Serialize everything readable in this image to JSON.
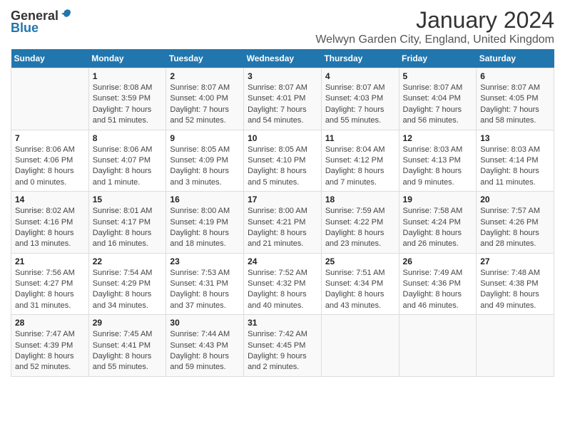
{
  "logo": {
    "general": "General",
    "blue": "Blue"
  },
  "header": {
    "title": "January 2024",
    "subtitle": "Welwyn Garden City, England, United Kingdom"
  },
  "days_of_week": [
    "Sunday",
    "Monday",
    "Tuesday",
    "Wednesday",
    "Thursday",
    "Friday",
    "Saturday"
  ],
  "weeks": [
    [
      {
        "num": "",
        "sunrise": "",
        "sunset": "",
        "daylight": ""
      },
      {
        "num": "1",
        "sunrise": "8:08 AM",
        "sunset": "3:59 PM",
        "daylight": "7 hours and 51 minutes."
      },
      {
        "num": "2",
        "sunrise": "8:07 AM",
        "sunset": "4:00 PM",
        "daylight": "7 hours and 52 minutes."
      },
      {
        "num": "3",
        "sunrise": "8:07 AM",
        "sunset": "4:01 PM",
        "daylight": "7 hours and 54 minutes."
      },
      {
        "num": "4",
        "sunrise": "8:07 AM",
        "sunset": "4:03 PM",
        "daylight": "7 hours and 55 minutes."
      },
      {
        "num": "5",
        "sunrise": "8:07 AM",
        "sunset": "4:04 PM",
        "daylight": "7 hours and 56 minutes."
      },
      {
        "num": "6",
        "sunrise": "8:07 AM",
        "sunset": "4:05 PM",
        "daylight": "7 hours and 58 minutes."
      }
    ],
    [
      {
        "num": "7",
        "sunrise": "8:06 AM",
        "sunset": "4:06 PM",
        "daylight": "8 hours and 0 minutes."
      },
      {
        "num": "8",
        "sunrise": "8:06 AM",
        "sunset": "4:07 PM",
        "daylight": "8 hours and 1 minute."
      },
      {
        "num": "9",
        "sunrise": "8:05 AM",
        "sunset": "4:09 PM",
        "daylight": "8 hours and 3 minutes."
      },
      {
        "num": "10",
        "sunrise": "8:05 AM",
        "sunset": "4:10 PM",
        "daylight": "8 hours and 5 minutes."
      },
      {
        "num": "11",
        "sunrise": "8:04 AM",
        "sunset": "4:12 PM",
        "daylight": "8 hours and 7 minutes."
      },
      {
        "num": "12",
        "sunrise": "8:03 AM",
        "sunset": "4:13 PM",
        "daylight": "8 hours and 9 minutes."
      },
      {
        "num": "13",
        "sunrise": "8:03 AM",
        "sunset": "4:14 PM",
        "daylight": "8 hours and 11 minutes."
      }
    ],
    [
      {
        "num": "14",
        "sunrise": "8:02 AM",
        "sunset": "4:16 PM",
        "daylight": "8 hours and 13 minutes."
      },
      {
        "num": "15",
        "sunrise": "8:01 AM",
        "sunset": "4:17 PM",
        "daylight": "8 hours and 16 minutes."
      },
      {
        "num": "16",
        "sunrise": "8:00 AM",
        "sunset": "4:19 PM",
        "daylight": "8 hours and 18 minutes."
      },
      {
        "num": "17",
        "sunrise": "8:00 AM",
        "sunset": "4:21 PM",
        "daylight": "8 hours and 21 minutes."
      },
      {
        "num": "18",
        "sunrise": "7:59 AM",
        "sunset": "4:22 PM",
        "daylight": "8 hours and 23 minutes."
      },
      {
        "num": "19",
        "sunrise": "7:58 AM",
        "sunset": "4:24 PM",
        "daylight": "8 hours and 26 minutes."
      },
      {
        "num": "20",
        "sunrise": "7:57 AM",
        "sunset": "4:26 PM",
        "daylight": "8 hours and 28 minutes."
      }
    ],
    [
      {
        "num": "21",
        "sunrise": "7:56 AM",
        "sunset": "4:27 PM",
        "daylight": "8 hours and 31 minutes."
      },
      {
        "num": "22",
        "sunrise": "7:54 AM",
        "sunset": "4:29 PM",
        "daylight": "8 hours and 34 minutes."
      },
      {
        "num": "23",
        "sunrise": "7:53 AM",
        "sunset": "4:31 PM",
        "daylight": "8 hours and 37 minutes."
      },
      {
        "num": "24",
        "sunrise": "7:52 AM",
        "sunset": "4:32 PM",
        "daylight": "8 hours and 40 minutes."
      },
      {
        "num": "25",
        "sunrise": "7:51 AM",
        "sunset": "4:34 PM",
        "daylight": "8 hours and 43 minutes."
      },
      {
        "num": "26",
        "sunrise": "7:49 AM",
        "sunset": "4:36 PM",
        "daylight": "8 hours and 46 minutes."
      },
      {
        "num": "27",
        "sunrise": "7:48 AM",
        "sunset": "4:38 PM",
        "daylight": "8 hours and 49 minutes."
      }
    ],
    [
      {
        "num": "28",
        "sunrise": "7:47 AM",
        "sunset": "4:39 PM",
        "daylight": "8 hours and 52 minutes."
      },
      {
        "num": "29",
        "sunrise": "7:45 AM",
        "sunset": "4:41 PM",
        "daylight": "8 hours and 55 minutes."
      },
      {
        "num": "30",
        "sunrise": "7:44 AM",
        "sunset": "4:43 PM",
        "daylight": "8 hours and 59 minutes."
      },
      {
        "num": "31",
        "sunrise": "7:42 AM",
        "sunset": "4:45 PM",
        "daylight": "9 hours and 2 minutes."
      },
      {
        "num": "",
        "sunrise": "",
        "sunset": "",
        "daylight": ""
      },
      {
        "num": "",
        "sunrise": "",
        "sunset": "",
        "daylight": ""
      },
      {
        "num": "",
        "sunrise": "",
        "sunset": "",
        "daylight": ""
      }
    ]
  ],
  "labels": {
    "sunrise": "Sunrise:",
    "sunset": "Sunset:",
    "daylight": "Daylight:"
  }
}
